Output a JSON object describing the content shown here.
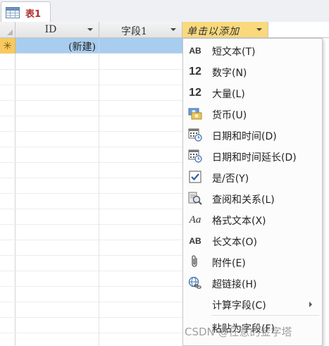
{
  "tab": {
    "label": "表1"
  },
  "columns": [
    {
      "header": "ID"
    },
    {
      "header": "字段1"
    },
    {
      "header": "单击以添加"
    }
  ],
  "new_row": {
    "selector_symbol": "✳",
    "id_value": "(新建)"
  },
  "menu": {
    "items": [
      {
        "icon": "short-text-icon",
        "glyph": "AB",
        "label": "短文本(T)"
      },
      {
        "icon": "number-icon",
        "glyph": "12",
        "label": "数字(N)"
      },
      {
        "icon": "large-number-icon",
        "glyph": "12",
        "label": "大量(L)"
      },
      {
        "icon": "currency-icon",
        "label": "货币(U)"
      },
      {
        "icon": "date-time-icon",
        "label": "日期和时间(D)"
      },
      {
        "icon": "date-time-extended-icon",
        "label": "日期和时间延长(D)"
      },
      {
        "icon": "checkbox-icon",
        "label": "是/否(Y)"
      },
      {
        "icon": "lookup-icon",
        "label": "查阅和关系(L)"
      },
      {
        "icon": "rich-text-icon",
        "glyph": "Aa",
        "label": "格式文本(X)"
      },
      {
        "icon": "long-text-icon",
        "glyph": "AB",
        "label": "长文本(O)"
      },
      {
        "icon": "attachment-icon",
        "label": "附件(E)"
      },
      {
        "icon": "hyperlink-icon",
        "label": "超链接(H)"
      },
      {
        "icon": "",
        "label": "计算字段(C)"
      },
      {
        "icon": "",
        "label": "粘贴为字段(F)"
      }
    ]
  },
  "watermark": "CSDN @任意的金字塔",
  "colors": {
    "tab_label": "#b03030",
    "new_row_bg": "#a8cdef",
    "active_header_bg": "#f9d97c",
    "selector_new_bg": "#f7c95f"
  }
}
